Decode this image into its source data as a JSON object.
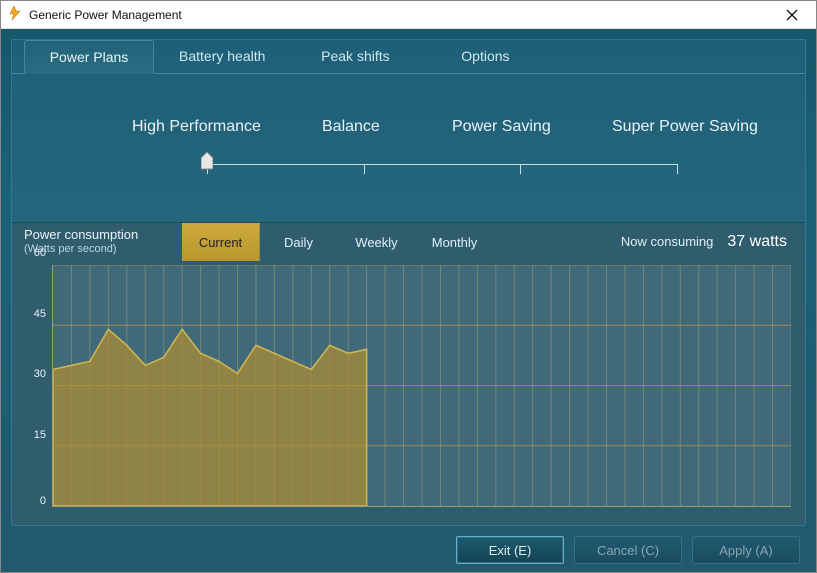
{
  "window": {
    "title": "Generic Power Management"
  },
  "tabs": [
    {
      "label": "Power Plans",
      "active": true
    },
    {
      "label": "Battery health",
      "active": false
    },
    {
      "label": "Peak shifts",
      "active": false
    },
    {
      "label": "Options",
      "active": false
    }
  ],
  "modes": {
    "labels": [
      "High Performance",
      "Balance",
      "Power Saving",
      "Super Power Saving"
    ],
    "selected_index": 0
  },
  "consumption": {
    "title": "Power consumption",
    "subtitle": "(Watts per second)",
    "periods": [
      {
        "label": "Current",
        "active": true
      },
      {
        "label": "Daily",
        "active": false
      },
      {
        "label": "Weekly",
        "active": false
      },
      {
        "label": "Monthly",
        "active": false
      }
    ],
    "now_label": "Now consuming",
    "now_value": "37 watts"
  },
  "chart_data": {
    "type": "area",
    "title": "",
    "xlabel": "",
    "ylabel": "",
    "ylim": [
      0,
      60
    ],
    "yticks": [
      0,
      15,
      30,
      45,
      60
    ],
    "x_count": 41,
    "series": [
      {
        "name": "watts",
        "values": [
          34,
          35,
          36,
          44,
          40,
          35,
          37,
          44,
          38,
          36,
          33,
          40,
          38,
          36,
          34,
          40,
          38,
          39
        ]
      }
    ],
    "colors": {
      "area_fill": "#a98e36",
      "area_stroke": "#d4b751",
      "grid": "#9aa36b",
      "major_grid": "#b59c3f"
    }
  },
  "footer": {
    "exit": "Exit (E)",
    "cancel": "Cancel (C)",
    "apply": "Apply (A)"
  }
}
